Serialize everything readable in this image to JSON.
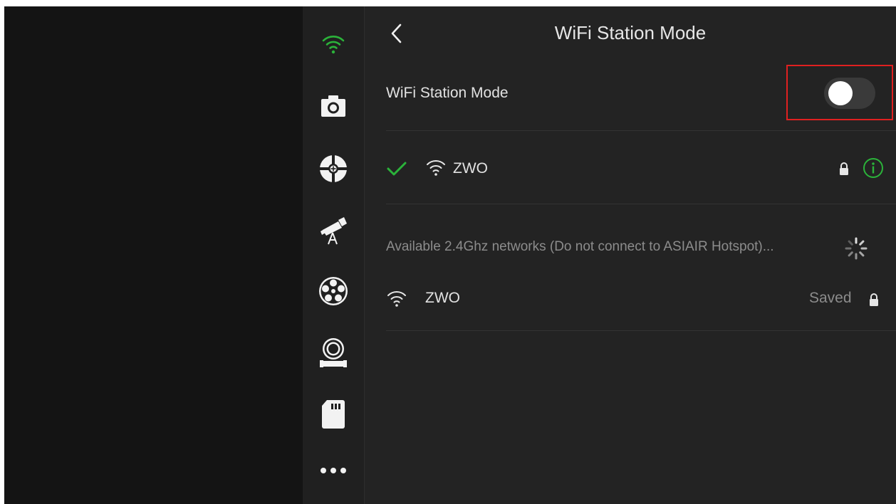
{
  "header": {
    "title": "WiFi Station Mode"
  },
  "station_mode": {
    "label": "WiFi Station Mode",
    "enabled": false
  },
  "connected_network": {
    "ssid": "ZWO"
  },
  "available": {
    "heading": "Available 2.4Ghz networks (Do not connect to ASIAIR Hotspot)...",
    "networks": [
      {
        "ssid": "ZWO",
        "status": "Saved"
      }
    ]
  },
  "sidebar": {
    "items": [
      {
        "icon": "wifi-icon",
        "active": true
      },
      {
        "icon": "camera-icon"
      },
      {
        "icon": "guide-icon"
      },
      {
        "icon": "telescope-icon"
      },
      {
        "icon": "filter-wheel-icon"
      },
      {
        "icon": "focuser-icon"
      },
      {
        "icon": "sd-card-icon"
      },
      {
        "icon": "more-icon"
      }
    ]
  },
  "colors": {
    "accent_green": "#2bb33a",
    "highlight_red": "#e02020",
    "panel_bg": "#232323",
    "rail_bg": "#202020"
  }
}
